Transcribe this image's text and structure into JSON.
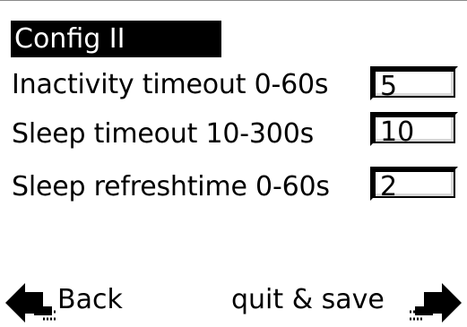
{
  "screen": {
    "title": "Config II"
  },
  "settings": {
    "inactivity": {
      "label": "Inactivity timeout 0-60s",
      "value": "5"
    },
    "sleep_timeout": {
      "label": "Sleep timeout 10-300s",
      "value": "10"
    },
    "sleep_refresh": {
      "label": "Sleep refreshtime 0-60s",
      "value": "2"
    }
  },
  "footer": {
    "back_label": "Back",
    "quit_label": "quit & save",
    "back_icon": "left-arrow-hand-icon",
    "quit_icon": "right-arrow-hand-icon"
  }
}
